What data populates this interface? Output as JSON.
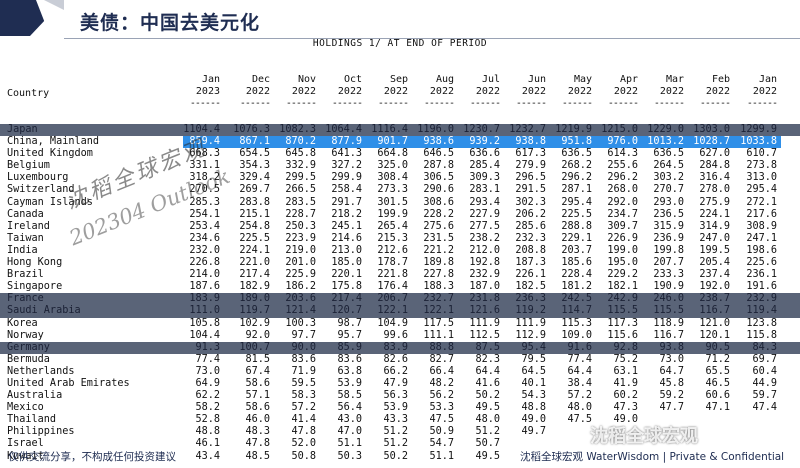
{
  "header": {
    "title": "美债：中国去美元化"
  },
  "table": {
    "title": "HOLDINGS 1/ AT END OF PERIOD",
    "country_header": "Country",
    "columns": [
      {
        "month": "Jan",
        "year": "2023"
      },
      {
        "month": "Dec",
        "year": "2022"
      },
      {
        "month": "Nov",
        "year": "2022"
      },
      {
        "month": "Oct",
        "year": "2022"
      },
      {
        "month": "Sep",
        "year": "2022"
      },
      {
        "month": "Aug",
        "year": "2022"
      },
      {
        "month": "Jul",
        "year": "2022"
      },
      {
        "month": "Jun",
        "year": "2022"
      },
      {
        "month": "May",
        "year": "2022"
      },
      {
        "month": "Apr",
        "year": "2022"
      },
      {
        "month": "Mar",
        "year": "2022"
      },
      {
        "month": "Feb",
        "year": "2022"
      },
      {
        "month": "Jan",
        "year": "2022"
      }
    ],
    "dashes": "------",
    "rows": [
      {
        "name": "Japan",
        "style": "gray",
        "values": [
          "1104.4",
          "1076.3",
          "1082.3",
          "1064.4",
          "1116.4",
          "1196.0",
          "1230.7",
          "1232.7",
          "1219.9",
          "1215.0",
          "1229.0",
          "1303.0",
          "1299.9"
        ]
      },
      {
        "name": "China, Mainland",
        "style": "blue",
        "values": [
          "859.4",
          "867.1",
          "870.2",
          "877.9",
          "901.7",
          "938.6",
          "939.2",
          "938.8",
          "951.8",
          "976.0",
          "1013.2",
          "1028.7",
          "1033.8"
        ]
      },
      {
        "name": "United Kingdom",
        "style": "",
        "values": [
          "668.3",
          "654.5",
          "645.8",
          "641.3",
          "664.8",
          "646.5",
          "636.6",
          "617.3",
          "636.5",
          "614.3",
          "636.5",
          "627.0",
          "610.7"
        ]
      },
      {
        "name": "Belgium",
        "style": "",
        "values": [
          "331.1",
          "354.3",
          "332.9",
          "327.2",
          "325.0",
          "287.8",
          "285.4",
          "279.9",
          "268.2",
          "255.6",
          "264.5",
          "284.8",
          "273.8"
        ]
      },
      {
        "name": "Luxembourg",
        "style": "",
        "values": [
          "318.2",
          "329.4",
          "299.5",
          "299.9",
          "308.4",
          "306.5",
          "309.3",
          "296.5",
          "296.2",
          "296.2",
          "303.2",
          "316.4",
          "313.0"
        ]
      },
      {
        "name": "Switzerland",
        "style": "",
        "values": [
          "270.5",
          "269.7",
          "266.5",
          "258.4",
          "273.3",
          "290.6",
          "283.1",
          "291.5",
          "287.1",
          "268.0",
          "270.7",
          "278.0",
          "295.4"
        ]
      },
      {
        "name": "Cayman Islands",
        "style": "",
        "values": [
          "285.3",
          "283.8",
          "283.5",
          "291.7",
          "301.5",
          "308.6",
          "293.4",
          "302.3",
          "295.4",
          "292.0",
          "293.0",
          "275.9",
          "272.1"
        ]
      },
      {
        "name": "Canada",
        "style": "",
        "values": [
          "254.1",
          "215.1",
          "228.7",
          "218.2",
          "199.9",
          "228.2",
          "227.9",
          "206.2",
          "225.5",
          "234.7",
          "236.5",
          "224.1",
          "217.6"
        ]
      },
      {
        "name": "Ireland",
        "style": "",
        "values": [
          "253.4",
          "254.8",
          "250.3",
          "245.1",
          "265.4",
          "275.6",
          "277.5",
          "285.6",
          "288.8",
          "309.7",
          "315.9",
          "314.9",
          "308.9"
        ]
      },
      {
        "name": "Taiwan",
        "style": "",
        "values": [
          "234.6",
          "225.5",
          "223.9",
          "214.6",
          "215.3",
          "231.5",
          "238.2",
          "232.3",
          "229.1",
          "226.9",
          "236.9",
          "247.0",
          "247.1"
        ]
      },
      {
        "name": "India",
        "style": "",
        "values": [
          "232.0",
          "224.1",
          "219.0",
          "213.0",
          "212.6",
          "221.2",
          "212.0",
          "208.8",
          "203.7",
          "199.0",
          "199.8",
          "199.5",
          "198.6"
        ]
      },
      {
        "name": "Hong Kong",
        "style": "",
        "values": [
          "226.8",
          "221.0",
          "201.0",
          "185.0",
          "178.7",
          "189.8",
          "192.8",
          "187.3",
          "185.6",
          "195.0",
          "207.7",
          "205.4",
          "225.6"
        ]
      },
      {
        "name": "Brazil",
        "style": "",
        "values": [
          "214.0",
          "217.4",
          "225.9",
          "220.1",
          "221.8",
          "227.8",
          "232.9",
          "226.1",
          "228.4",
          "229.2",
          "233.3",
          "237.4",
          "236.1"
        ]
      },
      {
        "name": "Singapore",
        "style": "",
        "values": [
          "187.6",
          "182.9",
          "186.2",
          "175.8",
          "176.4",
          "188.3",
          "187.0",
          "182.5",
          "181.2",
          "182.1",
          "190.9",
          "192.0",
          "191.6"
        ]
      },
      {
        "name": "France",
        "style": "gray",
        "values": [
          "183.9",
          "189.0",
          "203.6",
          "217.4",
          "206.7",
          "232.7",
          "231.8",
          "236.3",
          "242.5",
          "242.9",
          "246.0",
          "238.7",
          "232.9"
        ]
      },
      {
        "name": "Saudi Arabia",
        "style": "gray",
        "values": [
          "111.0",
          "119.7",
          "121.4",
          "120.7",
          "122.1",
          "122.1",
          "121.6",
          "119.2",
          "114.7",
          "115.5",
          "115.5",
          "116.7",
          "119.4"
        ]
      },
      {
        "name": "Korea",
        "style": "",
        "values": [
          "105.8",
          "102.9",
          "100.3",
          "98.7",
          "104.9",
          "117.5",
          "111.9",
          "111.9",
          "115.3",
          "117.3",
          "118.9",
          "121.0",
          "123.8"
        ]
      },
      {
        "name": "Norway",
        "style": "",
        "values": [
          "104.4",
          "92.0",
          "97.7",
          "95.7",
          "99.6",
          "111.1",
          "112.5",
          "112.9",
          "109.0",
          "115.6",
          "116.7",
          "120.1",
          "115.8"
        ]
      },
      {
        "name": "Germany",
        "style": "gray",
        "values": [
          "91.3",
          "100.7",
          "90.0",
          "85.9",
          "83.9",
          "88.8",
          "87.5",
          "95.4",
          "91.6",
          "92.8",
          "93.8",
          "90.5",
          "84.3"
        ]
      },
      {
        "name": "Bermuda",
        "style": "",
        "values": [
          "77.4",
          "81.5",
          "83.6",
          "83.6",
          "82.6",
          "82.7",
          "82.3",
          "79.5",
          "77.4",
          "75.2",
          "73.0",
          "71.2",
          "69.7"
        ]
      },
      {
        "name": "Netherlands",
        "style": "",
        "values": [
          "73.0",
          "67.4",
          "71.9",
          "63.8",
          "66.2",
          "66.4",
          "64.4",
          "64.5",
          "64.4",
          "63.1",
          "64.7",
          "65.5",
          "60.4"
        ]
      },
      {
        "name": "United Arab Emirates",
        "style": "",
        "values": [
          "64.9",
          "58.6",
          "59.5",
          "53.9",
          "47.9",
          "48.2",
          "41.6",
          "40.1",
          "38.4",
          "41.9",
          "45.8",
          "46.5",
          "44.9"
        ]
      },
      {
        "name": "Australia",
        "style": "",
        "values": [
          "62.2",
          "57.1",
          "58.3",
          "58.5",
          "56.3",
          "56.2",
          "50.2",
          "54.3",
          "57.2",
          "60.2",
          "59.2",
          "60.6",
          "59.7"
        ]
      },
      {
        "name": "Mexico",
        "style": "",
        "values": [
          "58.2",
          "58.6",
          "57.2",
          "56.4",
          "53.9",
          "53.3",
          "49.5",
          "48.8",
          "48.0",
          "47.3",
          "47.7",
          "47.1",
          "47.4"
        ]
      },
      {
        "name": "Thailand",
        "style": "",
        "values": [
          "52.8",
          "46.0",
          "41.4",
          "43.0",
          "43.3",
          "47.5",
          "48.0",
          "49.0",
          "47.5",
          "49.0",
          "",
          "",
          ""
        ]
      },
      {
        "name": "Philippines",
        "style": "",
        "values": [
          "48.8",
          "48.3",
          "47.8",
          "47.0",
          "51.2",
          "50.9",
          "51.2",
          "49.7",
          "",
          "",
          "",
          "",
          ""
        ]
      },
      {
        "name": "Israel",
        "style": "",
        "values": [
          "46.1",
          "47.8",
          "52.0",
          "51.1",
          "51.2",
          "54.7",
          "50.7",
          "",
          "",
          "",
          "",
          "",
          ""
        ]
      },
      {
        "name": "Kuwait",
        "style": "",
        "values": [
          "43.4",
          "48.5",
          "50.8",
          "50.3",
          "50.2",
          "51.1",
          "49.5",
          "",
          "",
          "",
          "",
          "",
          ""
        ]
      }
    ]
  },
  "watermarks": {
    "line1": "沈稻全球宏观",
    "line2": "202304 Outlook",
    "corner": "沈稻全球宏观"
  },
  "footer": {
    "left": "仅供交流分享，不构成任何投资建议",
    "right": "沈稻全球宏观 WaterWisdom | Private & Confidential"
  }
}
